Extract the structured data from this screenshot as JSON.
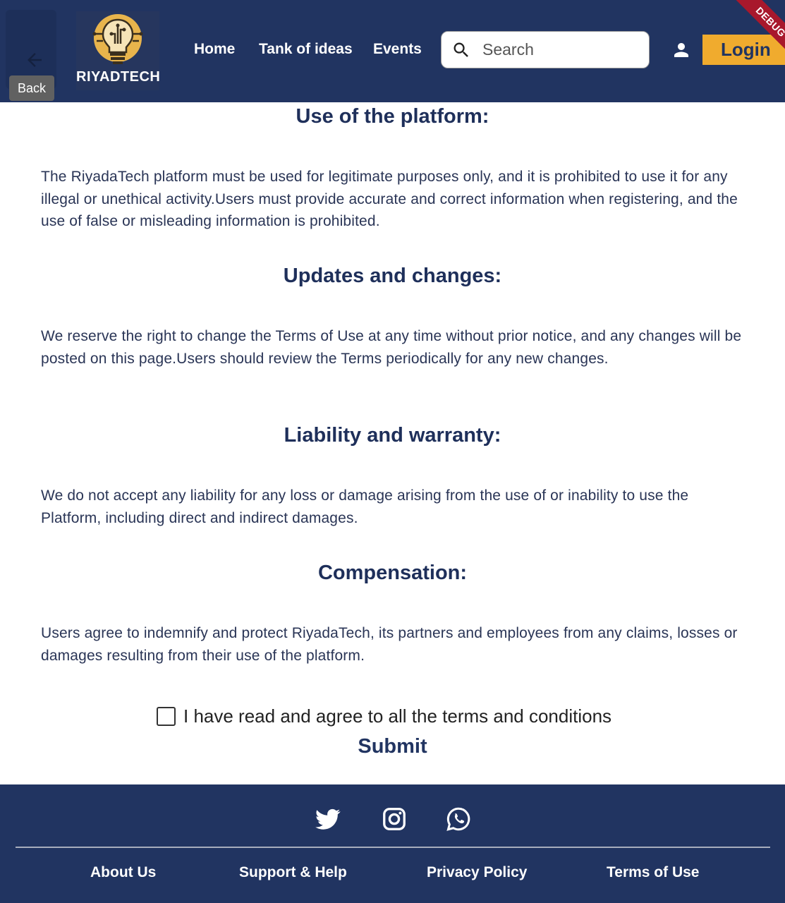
{
  "header": {
    "back_tooltip": "Back",
    "logo_text": "RIYADTECH",
    "nav": [
      "Home",
      "Tank of ideas",
      "Events"
    ],
    "search_placeholder": "Search",
    "login_label": "Login",
    "debug_banner": "DEBUG",
    "colors": {
      "bar": "#213461",
      "accent": "#f0ab2e",
      "ribbon": "#a8182c"
    }
  },
  "sections": [
    {
      "title": "Use of the platform:",
      "body": "The RiyadaTech platform must be used for legitimate purposes only, and it is prohibited to use it for any illegal or unethical activity.Users must provide accurate and correct information when registering, and the use of false or misleading information is prohibited."
    },
    {
      "title": "Updates and changes:",
      "body": "We reserve the right to change the Terms of Use at any time without prior notice, and any changes will be posted on this page.Users should review the Terms periodically for any new changes."
    },
    {
      "title": "Liability and warranty:",
      "body": "We do not accept any liability for any loss or damage arising from the use of or inability to use the Platform, including direct and indirect damages."
    },
    {
      "title": "Compensation:",
      "body": "Users agree to indemnify and protect RiyadaTech, its partners and employees from any claims, losses or damages resulting from their use of the platform."
    }
  ],
  "agreement": {
    "checkbox_label": "I have read and agree to all the terms and conditions",
    "checked": false,
    "submit_label": "Submit"
  },
  "footer": {
    "social_icons": [
      "twitter-icon",
      "instagram-icon",
      "whatsapp-icon"
    ],
    "links": [
      "About Us",
      "Support & Help",
      "Privacy Policy",
      "Terms of Use"
    ]
  }
}
